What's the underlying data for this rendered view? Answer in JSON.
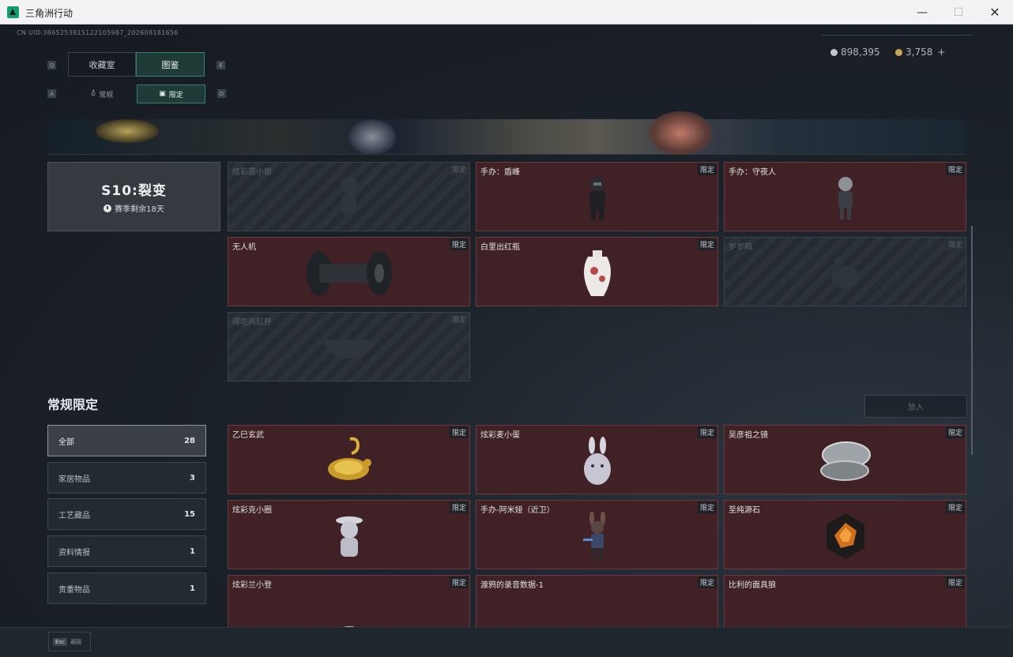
{
  "window": {
    "title": "三角洲行动"
  },
  "uid": "CN UID:3865253815122105987_202608181656",
  "currency": {
    "silver": "898,395",
    "gold": "3,758",
    "gold_add": "+"
  },
  "key_hints": {
    "q": "Q",
    "e": "E",
    "a": "A",
    "d": "D"
  },
  "tabs": [
    {
      "label": "收藏室"
    },
    {
      "label": "图鉴"
    }
  ],
  "subtabs": [
    {
      "label": "常规"
    },
    {
      "label": "限定"
    }
  ],
  "season": {
    "title": "S10:裂变",
    "remaining": "赛季剩余18天"
  },
  "season_items": [
    {
      "name": "炫彩露小娜",
      "tag": "限定",
      "locked": true
    },
    {
      "name": "手办：盾峰",
      "tag": "限定",
      "locked": false
    },
    {
      "name": "手办：守夜人",
      "tag": "限定",
      "locked": false
    },
    {
      "name": "无人机",
      "tag": "限定",
      "locked": false
    },
    {
      "name": "白里出红瓶",
      "tag": "限定",
      "locked": false
    },
    {
      "name": "岁岁鸣",
      "tag": "限定",
      "locked": true
    },
    {
      "name": "得吃鸡缸杯",
      "tag": "限定",
      "locked": true
    }
  ],
  "section": {
    "title": "常规限定",
    "place_button": "放入"
  },
  "categories": [
    {
      "label": "全部",
      "count": "28"
    },
    {
      "label": "家居物品",
      "count": "3"
    },
    {
      "label": "工艺藏品",
      "count": "15"
    },
    {
      "label": "资料情报",
      "count": "1"
    },
    {
      "label": "贵重物品",
      "count": "1"
    }
  ],
  "regular_items": [
    {
      "name": "乙巳玄武",
      "tag": "限定"
    },
    {
      "name": "炫彩麦小蛋",
      "tag": "限定"
    },
    {
      "name": "吴彦祖之镜",
      "tag": "限定"
    },
    {
      "name": "炫彩克小圈",
      "tag": "限定"
    },
    {
      "name": "手办-阿米娅（近卫）",
      "tag": "限定"
    },
    {
      "name": "至纯源石",
      "tag": "限定"
    },
    {
      "name": "炫彩兰小登",
      "tag": "限定"
    },
    {
      "name": "渡鸦的录音数据-1",
      "tag": "限定"
    },
    {
      "name": "比利的面具狼",
      "tag": "限定"
    }
  ],
  "bottom": {
    "esc_key": "Esc",
    "esc_label": "返回"
  },
  "colors": {
    "accent": "#3d7f6f",
    "card_bg": "#3f2126",
    "card_border": "#6a3a3e"
  }
}
